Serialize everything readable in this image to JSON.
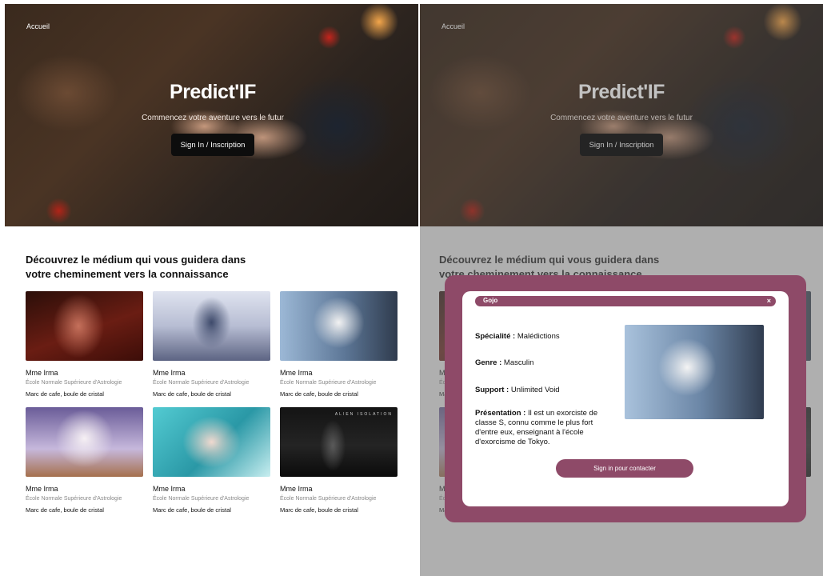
{
  "nav": {
    "home": "Accueil"
  },
  "hero": {
    "title": "Predict'IF",
    "subtitle": "Commencez votre aventure vers le futur",
    "signin_button": "Sign In / Inscription"
  },
  "section": {
    "title": "Découvrez le médium qui vous guidera dans votre cheminement vers la connaissance"
  },
  "cards": [
    {
      "name": "Mme Irma",
      "school": "École Normale Supérieure d'Astrologie",
      "tools": "Marc de cafe, boule de cristal"
    },
    {
      "name": "Mme Irma",
      "school": "École Normale Supérieure d'Astrologie",
      "tools": "Marc de cafe, boule de cristal"
    },
    {
      "name": "Mme Irma",
      "school": "École Normale Supérieure d'Astrologie",
      "tools": "Marc de cafe, boule de cristal"
    },
    {
      "name": "Mme Irma",
      "school": "École Normale Supérieure d'Astrologie",
      "tools": "Marc de cafe, boule de cristal"
    },
    {
      "name": "Mme Irma",
      "school": "École Normale Supérieure d'Astrologie",
      "tools": "Marc de cafe, boule de cristal"
    },
    {
      "name": "Mme Irma",
      "school": "École Normale Supérieure d'Astrologie",
      "tools": "Marc de cafe, boule de cristal",
      "image_caption": "ALIEN ISOLATION"
    }
  ],
  "modal": {
    "title": "Gojo",
    "close": "×",
    "speciality_label": "Spécialité :",
    "speciality_value": "Malédictions",
    "gender_label": "Genre :",
    "gender_value": "Masculin",
    "support_label": "Support :",
    "support_value": "Unlimited Void",
    "presentation_label": "Présentation :",
    "presentation_value": "Il est un exorciste de classe S, connu comme le plus fort d'entre eux, enseignant à l'école d'exorcisme de Tokyo.",
    "contact_button": "Sign in pour contacter"
  },
  "colors": {
    "accent": "#8e4a68",
    "button_dark": "#0d0d0d"
  }
}
